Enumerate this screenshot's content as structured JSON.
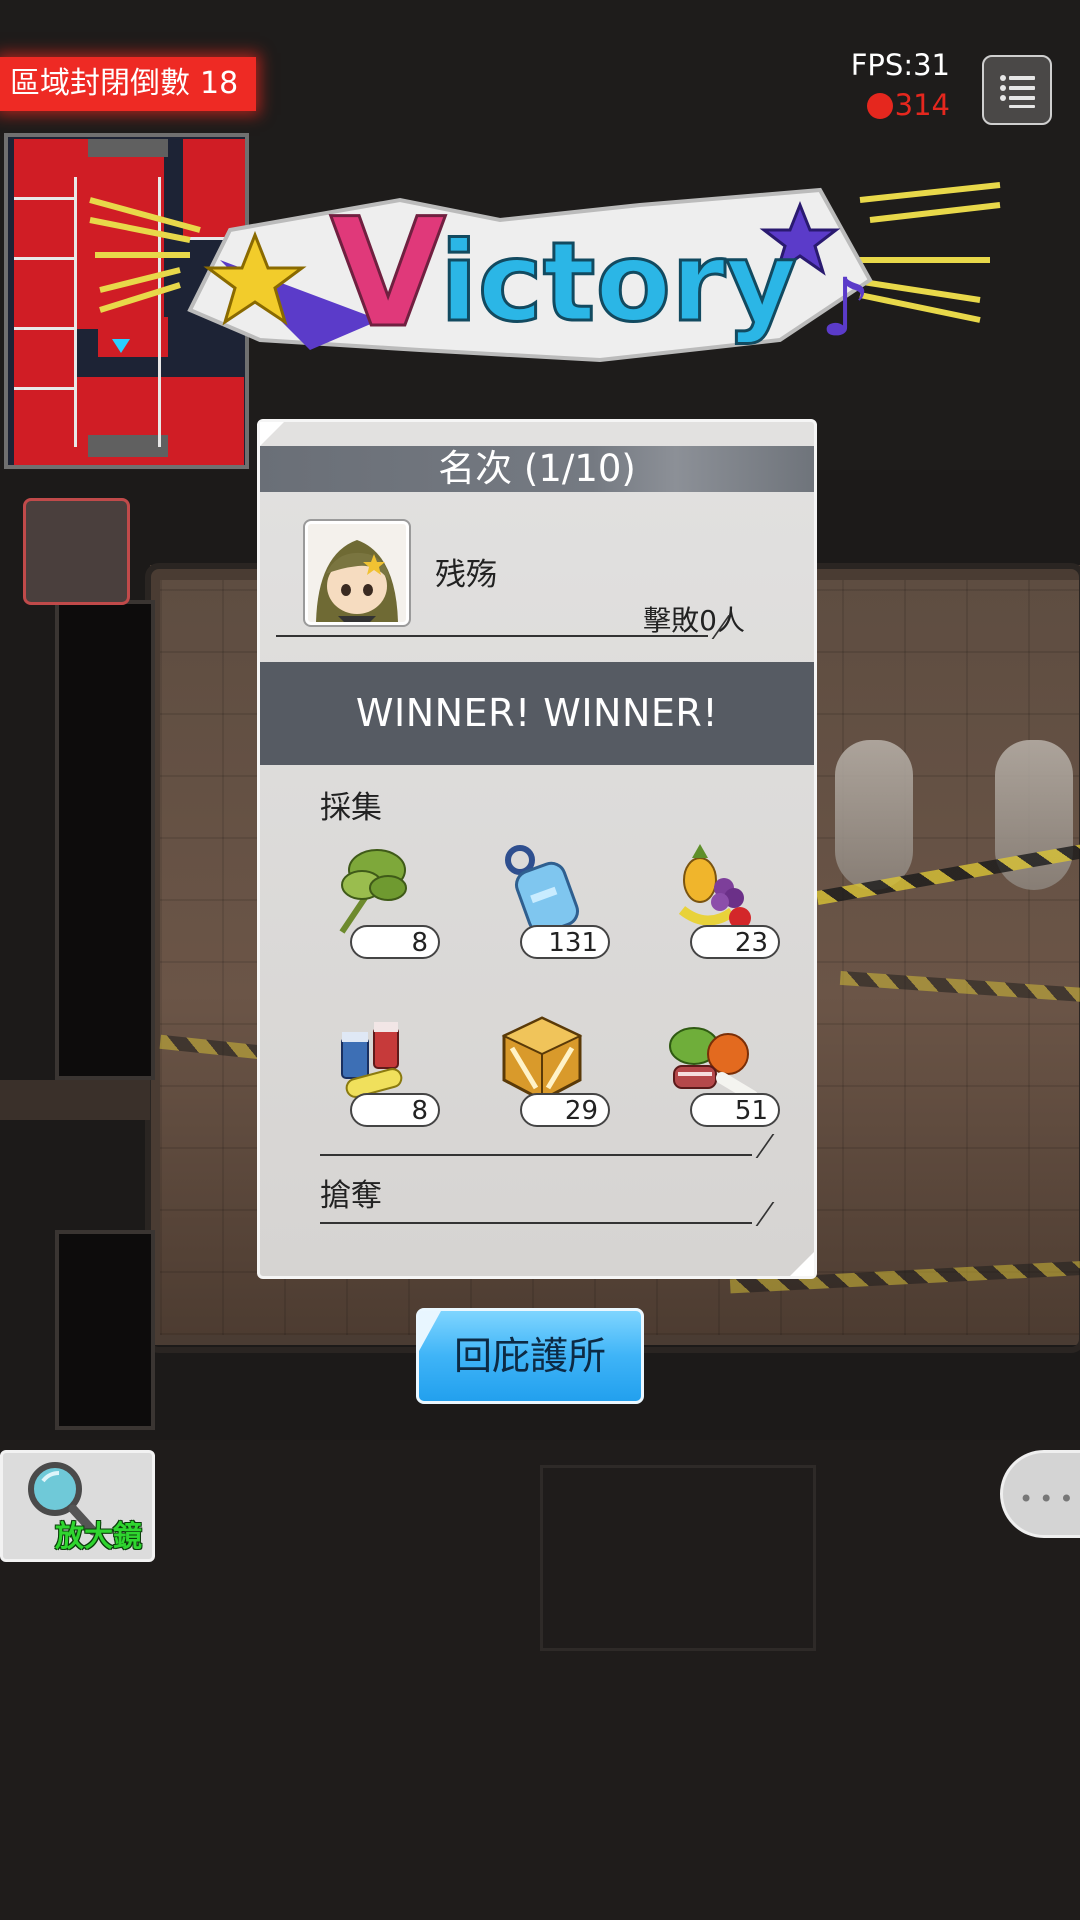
{
  "hud": {
    "countdown_label": "區域封閉倒數",
    "countdown_value": "18",
    "fps": "FPS:31",
    "ping": "314"
  },
  "banner": {
    "text": "Victory"
  },
  "result": {
    "rank_title": "名次 (1/10)",
    "player_name": "残殇",
    "kills": "擊敗0人",
    "winner_text": "WINNER! WINNER!",
    "gather_label": "採集",
    "loot_label": "搶奪",
    "items": [
      {
        "icon": "herb-icon",
        "count": "8"
      },
      {
        "icon": "water-bottle-icon",
        "count": "131"
      },
      {
        "icon": "fruit-icon",
        "count": "23"
      },
      {
        "icon": "medicine-icon",
        "count": "8"
      },
      {
        "icon": "supply-crate-icon",
        "count": "29"
      },
      {
        "icon": "vegetables-meat-icon",
        "count": "51"
      }
    ]
  },
  "return_button": "回庇護所",
  "tools": {
    "magnifier_label": "放大鏡"
  },
  "colors": {
    "alert_red": "#ee2a24",
    "winner_bar": "#565b63",
    "return_blue": "#3fb4f7",
    "magnifier_green": "#2fd52f"
  }
}
